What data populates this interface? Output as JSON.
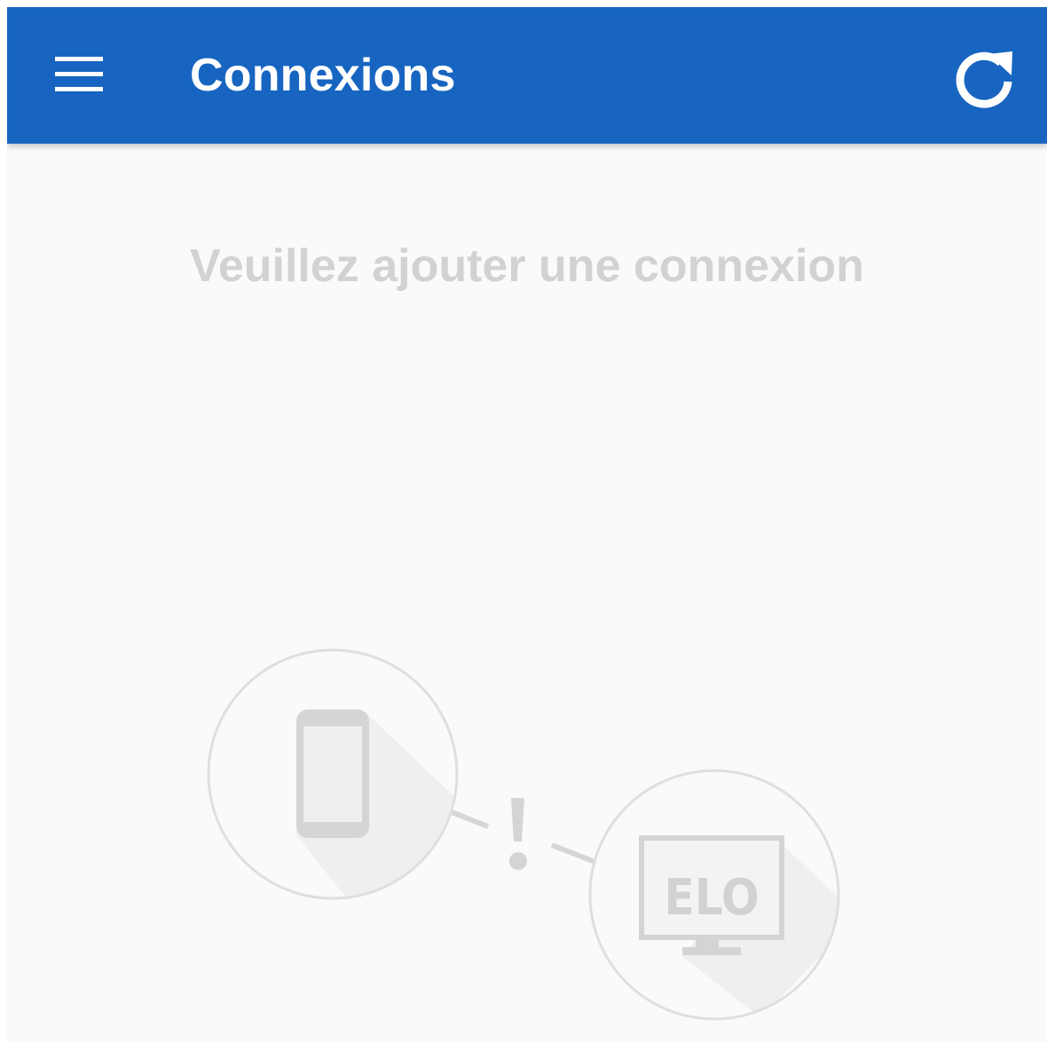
{
  "header": {
    "title": "Connexions",
    "menu_icon": "menu-icon",
    "refresh_icon": "refresh-icon",
    "background_color": "#1765c1"
  },
  "main": {
    "empty_message": "Veuillez ajouter une connexion",
    "illustration": {
      "device_icon": "smartphone-icon",
      "warning_mark": "!",
      "monitor_label": "ELO"
    }
  }
}
